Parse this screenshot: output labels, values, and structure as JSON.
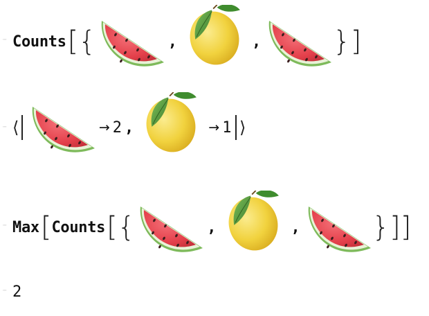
{
  "cells": [
    {
      "type": "input",
      "fn": "Counts",
      "open_bracket": "[",
      "close_bracket": "]",
      "open_brace": "{",
      "close_brace": "}",
      "comma": ",",
      "items": [
        "watermelon",
        "lemon",
        "watermelon"
      ]
    },
    {
      "type": "output",
      "assoc_open": "⟨",
      "assoc_close": "⟩",
      "rule": "→",
      "comma": ",",
      "entries": [
        {
          "key": "watermelon",
          "value": "2"
        },
        {
          "key": "lemon",
          "value": "1"
        }
      ]
    },
    {
      "type": "input",
      "outer_fn": "Max",
      "fn": "Counts",
      "open_bracket": "[",
      "close_bracket": "]",
      "open_brace": "{",
      "close_brace": "}",
      "comma": ",",
      "items": [
        "watermelon",
        "lemon",
        "watermelon"
      ]
    },
    {
      "type": "output",
      "value": "2"
    }
  ],
  "icons": {
    "watermelon": "watermelon-emoji",
    "lemon": "lemon-emoji"
  },
  "colors": {
    "watermelon_flesh": "#e8454e",
    "watermelon_rind": "#6aa84f",
    "lemon": "#f2d347",
    "leaf": "#4f8f3a"
  }
}
